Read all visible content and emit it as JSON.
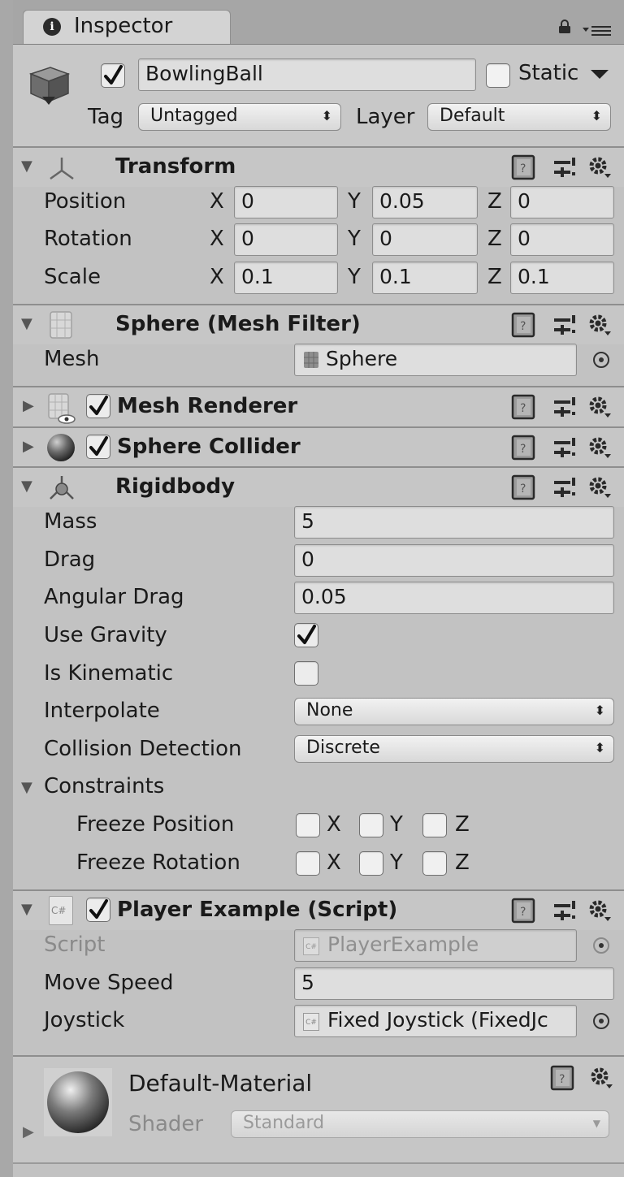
{
  "window": {
    "tab_title": "Inspector",
    "info_glyph": "i"
  },
  "gameobject": {
    "name": "BowlingBall",
    "active_checked": true,
    "static_label": "Static",
    "static_checked": false,
    "tag_label": "Tag",
    "tag_value": "Untagged",
    "layer_label": "Layer",
    "layer_value": "Default"
  },
  "transform": {
    "title": "Transform",
    "rows": [
      {
        "label": "Position",
        "x": "0",
        "y": "0.05",
        "z": "0"
      },
      {
        "label": "Rotation",
        "x": "0",
        "y": "0",
        "z": "0"
      },
      {
        "label": "Scale",
        "x": "0.1",
        "y": "0.1",
        "z": "0.1"
      }
    ],
    "axis_x": "X",
    "axis_y": "Y",
    "axis_z": "Z"
  },
  "mesh_filter": {
    "title": "Sphere (Mesh Filter)",
    "mesh_label": "Mesh",
    "mesh_value": "Sphere"
  },
  "mesh_renderer": {
    "title": "Mesh Renderer",
    "enabled": true
  },
  "sphere_collider": {
    "title": "Sphere Collider",
    "enabled": true
  },
  "rigidbody": {
    "title": "Rigidbody",
    "mass_label": "Mass",
    "mass": "5",
    "drag_label": "Drag",
    "drag": "0",
    "angular_drag_label": "Angular Drag",
    "angular_drag": "0.05",
    "use_gravity_label": "Use Gravity",
    "use_gravity": true,
    "is_kinematic_label": "Is Kinematic",
    "is_kinematic": false,
    "interpolate_label": "Interpolate",
    "interpolate": "None",
    "collision_label": "Collision Detection",
    "collision": "Discrete",
    "constraints_label": "Constraints",
    "freeze_position_label": "Freeze Position",
    "freeze_rotation_label": "Freeze Rotation",
    "axis_x": "X",
    "axis_y": "Y",
    "axis_z": "Z"
  },
  "player_script": {
    "title": "Player Example (Script)",
    "enabled": true,
    "file_icon_text": "C#",
    "script_label": "Script",
    "script_value": "PlayerExample",
    "move_speed_label": "Move Speed",
    "move_speed": "5",
    "joystick_label": "Joystick",
    "joystick_value": "Fixed Joystick (FixedJc"
  },
  "material": {
    "name": "Default-Material",
    "shader_label": "Shader",
    "shader_value": "Standard"
  },
  "icons": [
    "info-icon",
    "lock-icon",
    "menu-icon",
    "cube-icon",
    "transform-icon",
    "mesh-icon",
    "renderer-icon",
    "sphere-icon",
    "rigidbody-icon",
    "script-icon",
    "book-icon",
    "presets-icon",
    "gear-icon",
    "object-picker-icon",
    "material-sphere-icon"
  ],
  "colors": {
    "panel_bg": "#c2c2c2",
    "field_bg": "#dedede",
    "header_bg": "#c6c6c6"
  }
}
